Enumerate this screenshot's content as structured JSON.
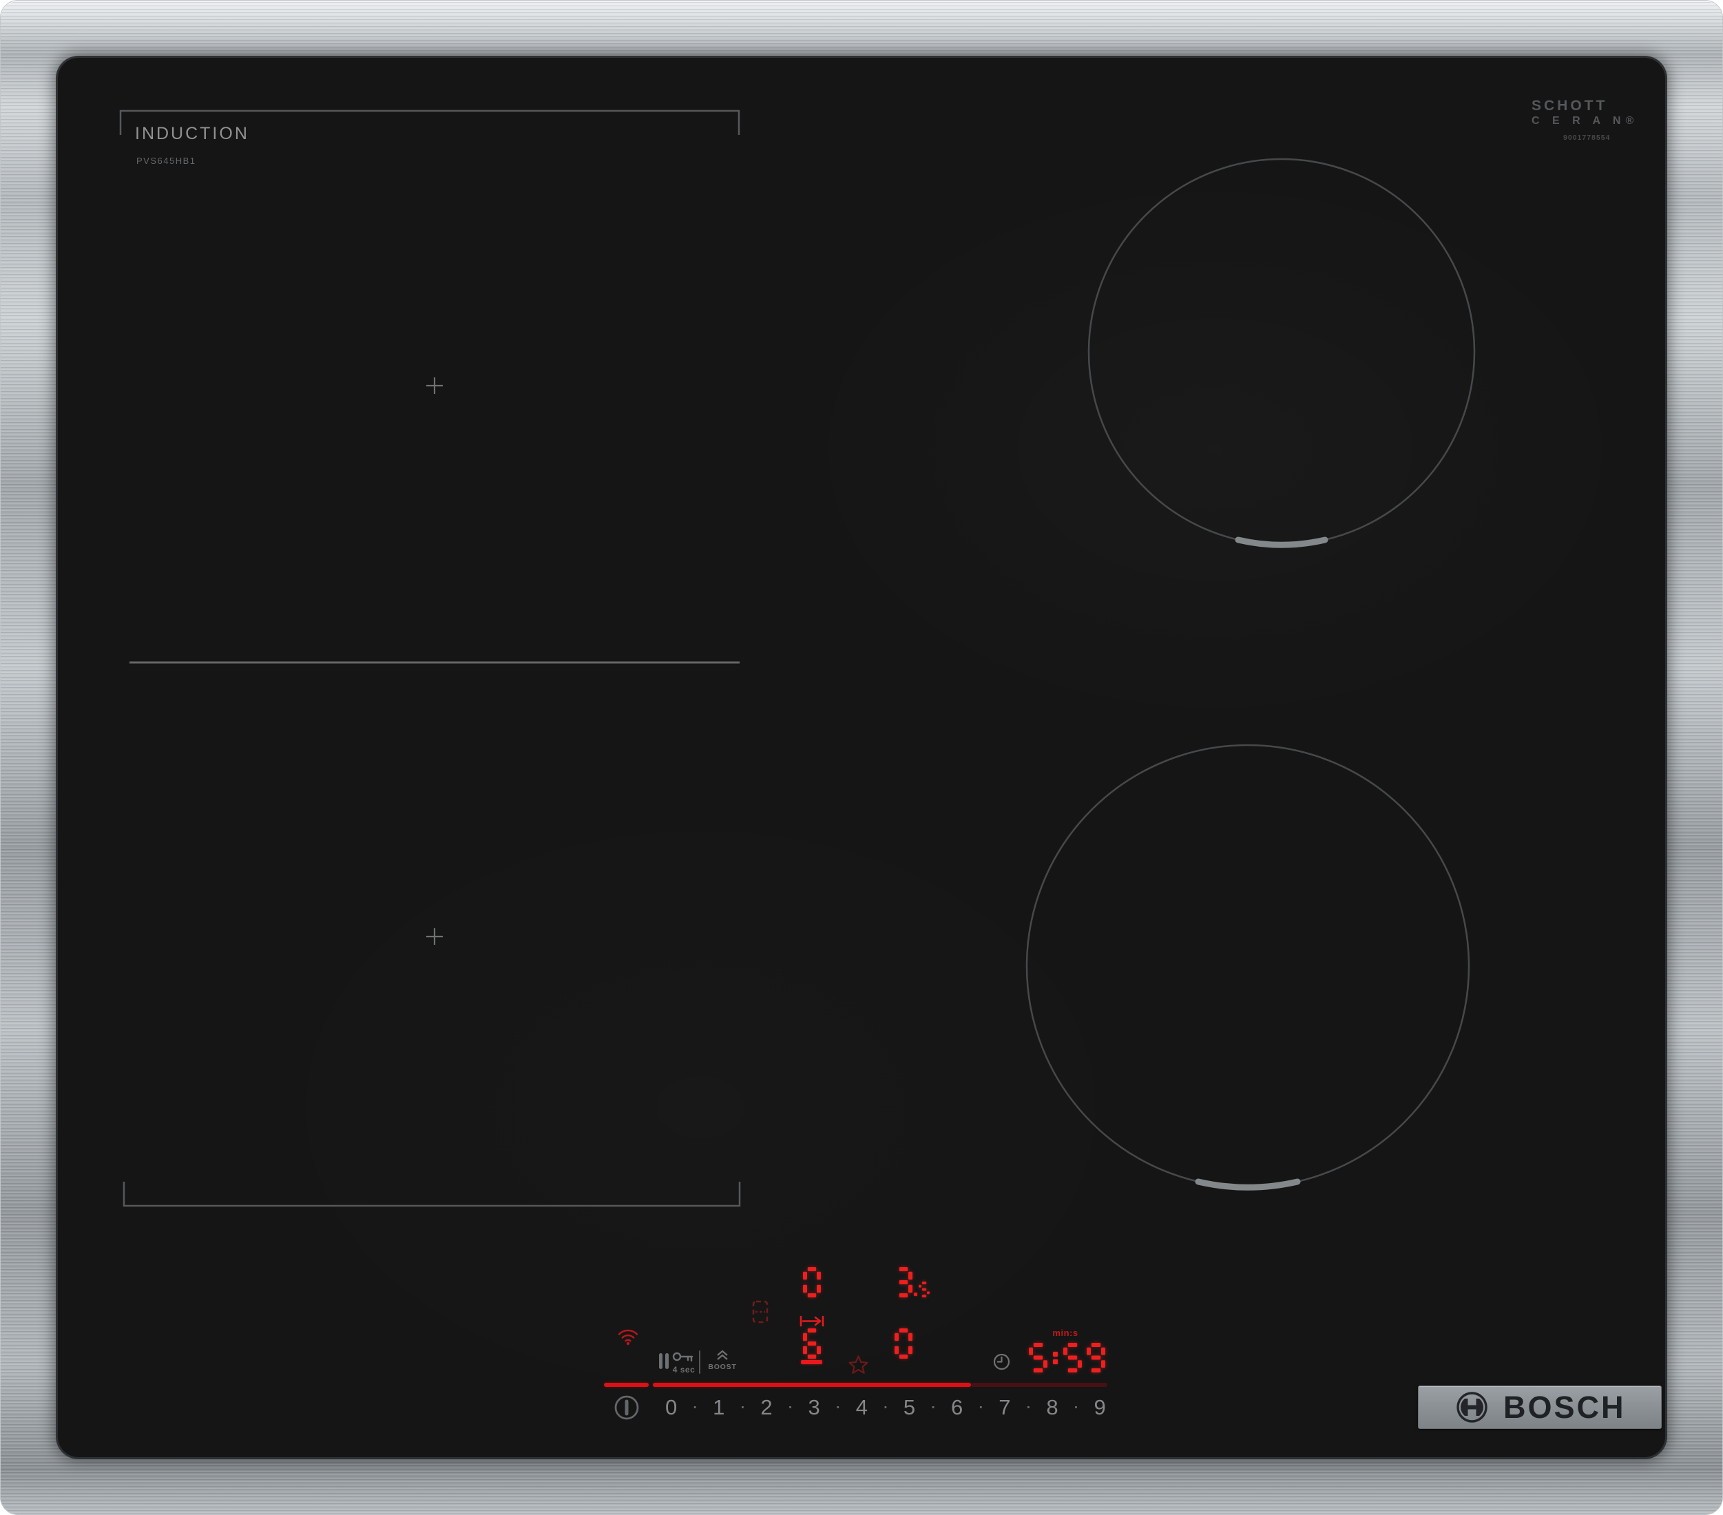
{
  "colors": {
    "glass": "#151515",
    "steel": "#b2b7bb",
    "accent_red": "#ec1c1e",
    "dim_red": "#6f1b19",
    "icon_gray": "#6e7173",
    "number_gray": "#84878a"
  },
  "markings": {
    "label_title": "INDUCTION",
    "label_model": "PVS645HB1",
    "glass_brand_line1": "SCHOTT",
    "glass_brand_line2": "C E R A N®",
    "glass_serial": "9001778554"
  },
  "brand": {
    "name": "BOSCH"
  },
  "panel": {
    "lock_duration_label": "4 sec",
    "boost_label": "BOOST",
    "timer_unit_label": "min:s",
    "flex_top_power": "0",
    "flex_bottom_power": "6",
    "rear_right_power_int": "3",
    "rear_right_power_frac": "5",
    "front_right_power": "0",
    "timer_digits": [
      "5",
      "5",
      "9"
    ],
    "slider_numbers": [
      "0",
      "1",
      "2",
      "3",
      "4",
      "5",
      "6",
      "7",
      "8",
      "9"
    ],
    "slider_dot": "·"
  }
}
